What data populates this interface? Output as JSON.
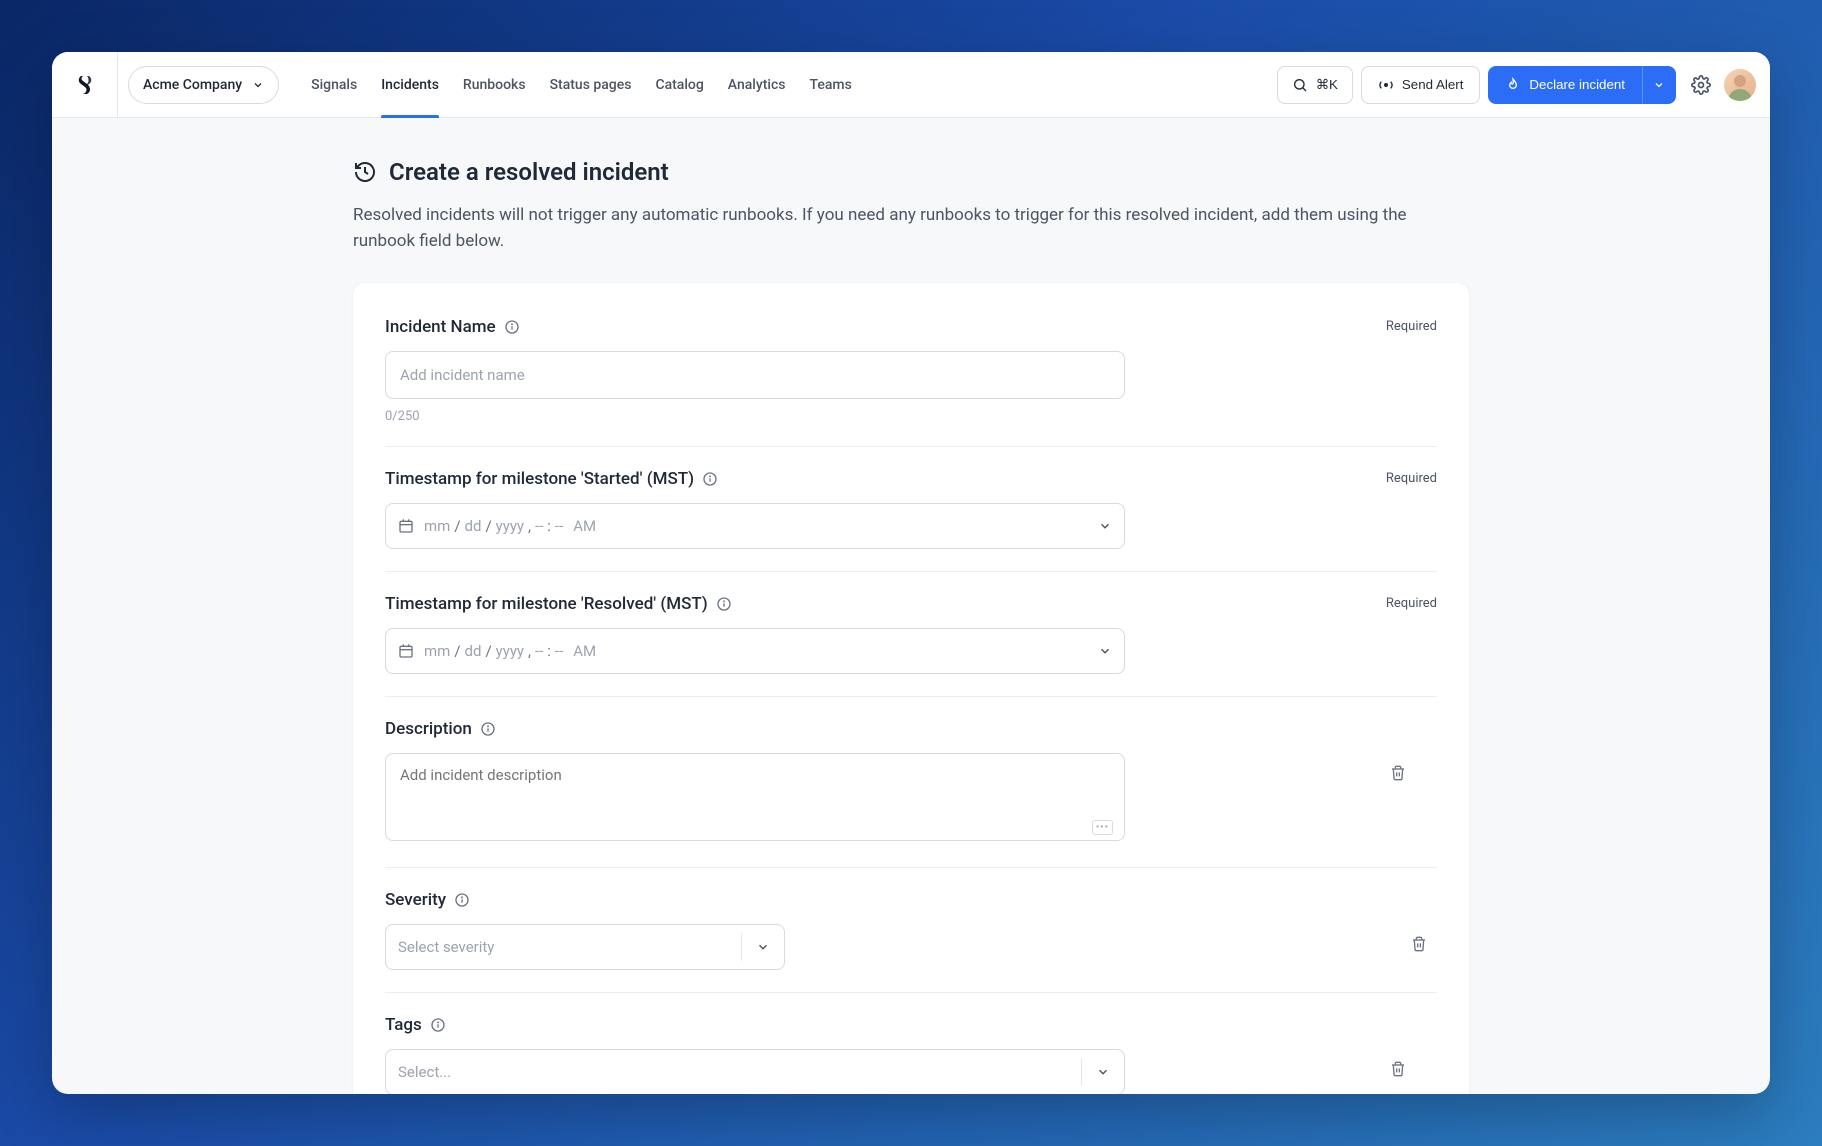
{
  "company": "Acme Company",
  "nav": {
    "signals": "Signals",
    "incidents": "Incidents",
    "runbooks": "Runbooks",
    "status_pages": "Status pages",
    "catalog": "Catalog",
    "analytics": "Analytics",
    "teams": "Teams"
  },
  "search_shortcut": "⌘K",
  "send_alert": "Send Alert",
  "declare_incident": "Declare incident",
  "page": {
    "title": "Create a resolved incident",
    "description": "Resolved incidents will not trigger any automatic runbooks. If you need any runbooks to trigger for this resolved incident, add them using the runbook field below."
  },
  "labels": {
    "incident_name": "Incident Name",
    "required": "Required",
    "timestamp_started": "Timestamp for milestone 'Started' (MST)",
    "timestamp_resolved": "Timestamp for milestone 'Resolved' (MST)",
    "description": "Description",
    "severity": "Severity",
    "tags": "Tags"
  },
  "placeholders": {
    "incident_name": "Add incident name",
    "description": "Add incident description",
    "severity": "Select severity",
    "tags": "Select..."
  },
  "counter": "0/250",
  "dt": {
    "mm": "mm",
    "dd": "dd",
    "yyyy": "yyyy",
    "hh": "--",
    "min": "--",
    "ampm": "AM"
  },
  "md_badge": "•••"
}
